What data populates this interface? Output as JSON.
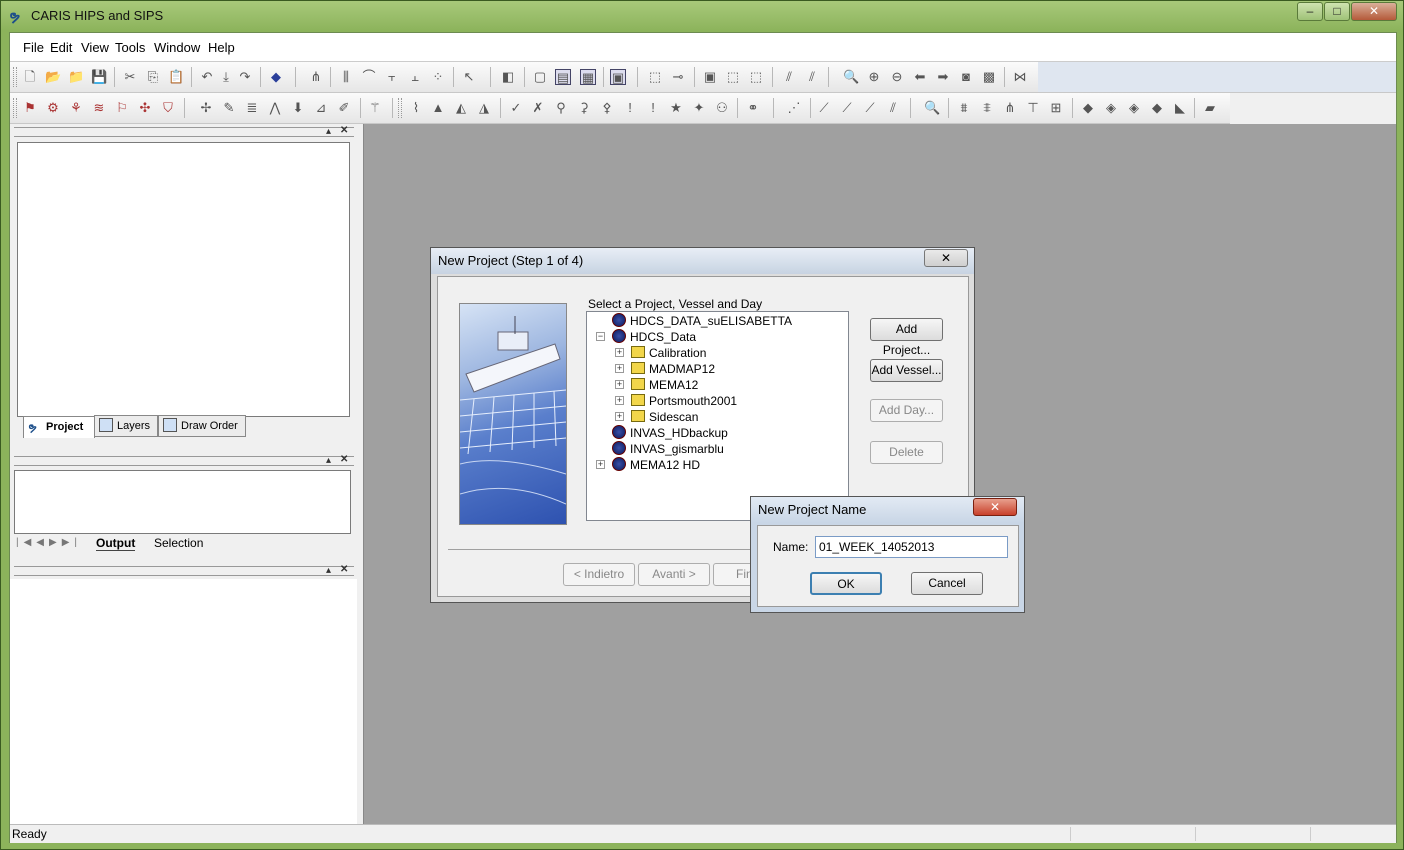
{
  "app": {
    "title": "CARIS HIPS and SIPS"
  },
  "window_controls": {
    "minimize": "–",
    "maximize": "□",
    "close": "✕"
  },
  "menu": [
    "File",
    "Edit",
    "View",
    "Tools",
    "Window",
    "Help"
  ],
  "left_panel": {
    "tabs": [
      "Project",
      "Layers",
      "Draw Order"
    ],
    "output_tabs": [
      "Output",
      "Selection"
    ],
    "nav": [
      "|◀",
      "◀",
      "▶",
      "▶|"
    ]
  },
  "status": {
    "text": "Ready"
  },
  "new_project_dialog": {
    "title": "New Project (Step 1 of 4)",
    "close": "✕",
    "group_label": "Select a Project, Vessel and Day",
    "tree": [
      {
        "label": "HDCS_DATA_suELISABETTA",
        "type": "project",
        "level": 0,
        "expander": ""
      },
      {
        "label": "HDCS_Data",
        "type": "project",
        "level": 0,
        "expander": "−"
      },
      {
        "label": "Calibration",
        "type": "vessel",
        "level": 1,
        "expander": "+"
      },
      {
        "label": "MADMAP12",
        "type": "vessel",
        "level": 1,
        "expander": "+"
      },
      {
        "label": "MEMA12",
        "type": "vessel",
        "level": 1,
        "expander": "+"
      },
      {
        "label": "Portsmouth2001",
        "type": "vessel",
        "level": 1,
        "expander": "+"
      },
      {
        "label": "Sidescan",
        "type": "vessel",
        "level": 1,
        "expander": "+"
      },
      {
        "label": "INVAS_HDbackup",
        "type": "project",
        "level": 0,
        "expander": ""
      },
      {
        "label": "INVAS_gismarblu",
        "type": "project",
        "level": 0,
        "expander": ""
      },
      {
        "label": "MEMA12 HD",
        "type": "project",
        "level": 0,
        "expander": "+"
      }
    ],
    "buttons": {
      "add_project": "Add Project...",
      "add_vessel": "Add Vessel...",
      "add_day": "Add Day...",
      "delete": "Delete"
    },
    "nav_buttons": {
      "back": "< Indietro",
      "next": "Avanti >",
      "finish": "Fine"
    }
  },
  "name_dialog": {
    "title": "New Project Name",
    "close": "✕",
    "name_label": "Name:",
    "name_value": "01_WEEK_14052013",
    "ok": "OK",
    "cancel": "Cancel"
  }
}
